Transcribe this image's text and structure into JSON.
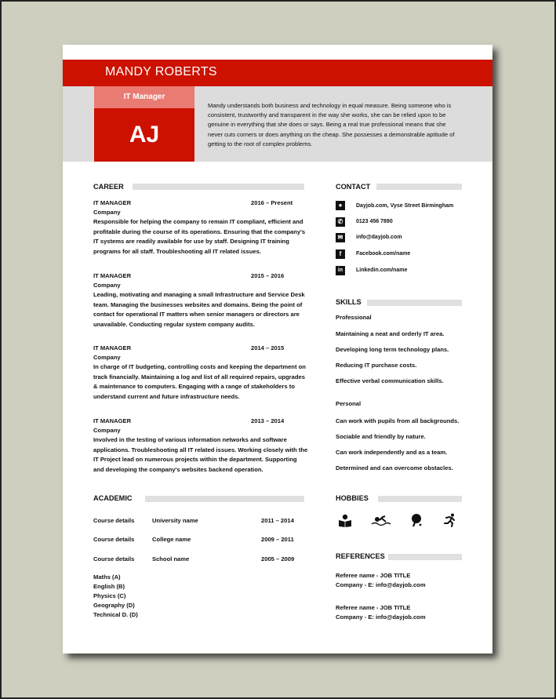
{
  "header": {
    "name": "MANDY ROBERTS",
    "role": "IT Manager",
    "initials": "AJ",
    "summary": "Mandy understands both business and technology in equal measure. Being someone who is consistent, trustworthy and transparent in the way she works, she can be relied upon to be genuine in everything that she does or says. Being a real true professional means that she never cuts corners or does anything on the cheap. She possesses a demonstrable aptitude of getting to the root of complex problems."
  },
  "colors": {
    "accent": "#cc1100",
    "accent_light": "#e97b72",
    "band_grey": "#dcdcdc",
    "background": "#cfcfc0"
  },
  "career": {
    "title": "CAREER",
    "jobs": [
      {
        "title": "IT MANAGER",
        "dates": "2016 – Present",
        "company": "Company",
        "description": "Responsible for helping the company to remain IT compliant, efficient and profitable during the course of its operations. Ensuring that the company's IT systems are readily available for use by staff. Designing IT training programs for all staff. Troubleshooting all IT related issues."
      },
      {
        "title": "IT MANAGER",
        "dates": "2015 – 2016",
        "company": "Company",
        "description": "Leading, motivating and managing a small Infrastructure and Service Desk team. Managing the businesses websites and domains. Being the point of contact for operational IT matters when senior managers or directors are unavailable. Conducting regular system company audits."
      },
      {
        "title": "IT MANAGER",
        "dates": "2014 – 2015",
        "company": "Company",
        "description": "In charge of IT budgeting, controlling costs and keeping the department on track financially. Maintaining a log and list of all required repairs, upgrades & maintenance to computers. Engaging with a range of stakeholders to understand current and future infrastructure needs."
      },
      {
        "title": "IT MANAGER",
        "dates": "2013 – 2014",
        "company": "Company",
        "description": "Involved in the testing of various information networks and software applications. Troubleshooting all IT related issues. Working closely with the IT Project lead on numerous projects within the department. Supporting and developing the company's websites backend operation."
      }
    ]
  },
  "academic": {
    "title": "ACADEMIC",
    "entries": [
      {
        "course": "Course details",
        "institution": "University name",
        "dates": "2011 – 2014"
      },
      {
        "course": "Course details",
        "institution": "College name",
        "dates": "2009 – 2011"
      },
      {
        "course": "Course details",
        "institution": "School name",
        "dates": "2005 – 2009"
      }
    ],
    "grades": [
      "Maths (A)",
      "English (B)",
      "Physics (C)",
      "Geography (D)",
      "Technical D. (D)"
    ]
  },
  "contact": {
    "title": "CONTACT",
    "items": [
      {
        "icon": "location-pin-icon",
        "glyph": "●",
        "text": "Dayjob.com, Vyse Street Birmingham"
      },
      {
        "icon": "phone-icon",
        "glyph": "✆",
        "text": "0123 456 7890"
      },
      {
        "icon": "email-icon",
        "glyph": "✉",
        "text": "info@dayjob.com"
      },
      {
        "icon": "facebook-icon",
        "glyph": "f",
        "text": "Facebook.com/name"
      },
      {
        "icon": "linkedin-icon",
        "glyph": "in",
        "text": "Linkedin.com/name"
      }
    ]
  },
  "skills": {
    "title": "SKILLS",
    "professional_label": "Professional",
    "professional": [
      "Maintaining a neat and orderly IT area.",
      "Developing long term technology plans.",
      "Reducing IT purchase costs.",
      "Effective verbal communication skills."
    ],
    "personal_label": "Personal",
    "personal": [
      "Can work with pupils from all backgrounds.",
      "Sociable and friendly by nature.",
      "Can work independently and as a team.",
      "Determined and can overcome obstacles."
    ]
  },
  "hobbies": {
    "title": "HOBBIES",
    "icons": [
      "reading-icon",
      "swimming-icon",
      "table-tennis-icon",
      "running-icon"
    ]
  },
  "references": {
    "title": "REFERENCES",
    "items": [
      {
        "name": "Referee name - JOB TITLE",
        "contact": "Company - E: info@dayjob.com"
      },
      {
        "name": "Referee name - JOB TITLE",
        "contact": "Company - E: info@dayjob.com"
      }
    ]
  }
}
